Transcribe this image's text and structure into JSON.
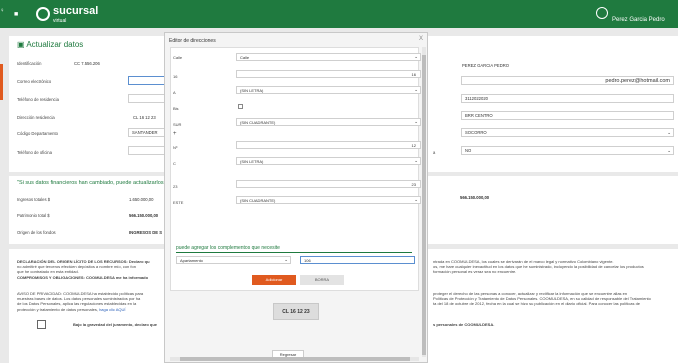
{
  "header": {
    "brand": "sucursal",
    "brand_sub": "virtual",
    "user_name": "Perez Garcia Pedro",
    "menu_icon": "hamburger-icon",
    "user_icon": "user-circle-icon",
    "edge_glyph": "♀"
  },
  "page": {
    "title": "Actualizar datos",
    "title_icon": "back-arrow-icon"
  },
  "form": {
    "identificacion_label": "Identificación",
    "identificacion_value": "CC 7.556.206",
    "nombre_value": "PEREZ GARCIA PEDRO",
    "correo_label": "Correo electrónico",
    "correo_value": "pedro.perez@hotmail.com",
    "telefono_residencia_label": "Teléfono de residencia",
    "celular_value": "3112022020",
    "direccion_residencia_label": "Dirección residencia",
    "direccion_residencia_value": "CL 16 12 23",
    "barrio_value": "BRR CENTRO",
    "codigo_departamento_label": "Código Departamento",
    "departamento_value": "SANTANDER",
    "municipio_value": "SOCORRO",
    "telefono_oficina_label": "Teléfono de oficina",
    "right_select_label": "a",
    "right_select_value": "NO"
  },
  "financial": {
    "title": "\"Si sus datos financieros han cambiado, puede actualizarlos",
    "ingresos_label": "Ingresos totales $",
    "ingresos_value": "1.650.000,00",
    "egresos_value": "566.150.000,00",
    "patrimonio_label": "Patrimonio total $",
    "patrimonio_value": "566.150.000,00",
    "origen_label": "Origen de los fondos",
    "origen_value": "INGRESOS DE S"
  },
  "legal": {
    "p1_left": "DECLARACIÓN DEL ORIGEN LÍCITO DE LOS RECURSOS: Declaro qu",
    "p1_left2": "no admitiré que terceros efectúen depósitos a nombre mío, con fon",
    "p1_left3": "que he contratado en esta entidad.",
    "p1_left4": "COMPROMISOS Y OBLIGACIONES: COOMULDESA me ha informado",
    "p1_right": "ntrada en COOMULDESA, los cuales se derivarán de el marco legal y normativo Colombiano vigente.",
    "p1_right2": "os, me hare cualquier inexactitud en los datos que he suministrado, incluyendo la posibilidad de cancelar los productos",
    "p1_right3": "formación personal es veraz sea no encuentre.",
    "p2_left": "AVISO DE PRIVACIDAD: COOMULDESA ha establecido políticas para",
    "p2_left2": "muestras bases de datos. Los datos personales suministrados por ha",
    "p2_left3": "de los Datos Personales, aplica las regulaciones establecidas en la",
    "p2_left4": "protección y tratamiento de datos personales,",
    "p2_link": "haga clic AQUÍ",
    "p2_right": "proteger el derecho de las personas a conocer, actualizar y rectificar la información que se encuentre allas en",
    "p2_right2": "Políticas de Protección y Tratamiento de Datos Personales. COOMULDESA, en su calidad de responsable del Tratamiento",
    "p2_right3": "ta del 18 de octubre de 2012, fecha en la cual se hizo su publicación en el diario oficial. Para conocer las políticas de",
    "oath_left": "Bajo la gravedad del juramento, declaro que",
    "oath_right": "s personales de COOMULDESA."
  },
  "modal": {
    "title": "Editor de direcciones",
    "close": "X",
    "rows": [
      {
        "label": "Calle",
        "value": "Calle",
        "kind": "select"
      },
      {
        "label": "16",
        "value": "16",
        "kind": "input"
      },
      {
        "label": "A",
        "value": "(SIN LETRA)",
        "kind": "select"
      },
      {
        "label": "Bis",
        "value": "",
        "kind": "checkbox"
      },
      {
        "label": "SUR",
        "value": "(SIN CUADRANTE)",
        "kind": "select"
      },
      {
        "label": "Nº",
        "value": "12",
        "kind": "input"
      },
      {
        "label": "C",
        "value": "(SIN LETRA)",
        "kind": "select"
      },
      {
        "label": "23",
        "value": "23",
        "kind": "input"
      },
      {
        "label": "ESTE",
        "value": "(SIN CUADRANTE)",
        "kind": "select"
      }
    ],
    "complement_title": "puede agregar los complementos que necesite",
    "complement_type": "Apartamento",
    "complement_value": "106",
    "save_label": "Adicionar",
    "delete_label": "BORRA",
    "address_result": "CL 16 12 23",
    "back_label": "Regresar"
  }
}
